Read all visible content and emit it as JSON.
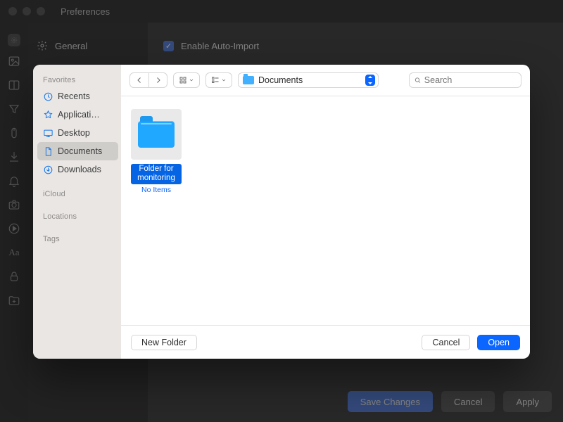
{
  "window": {
    "title": "Preferences"
  },
  "sidebar_general": "General",
  "pref": {
    "auto_import_label": "Enable Auto-Import",
    "save": "Save Changes",
    "cancel": "Cancel",
    "apply": "Apply"
  },
  "chooser": {
    "sidebar": {
      "favorites_heading": "Favorites",
      "icloud_heading": "iCloud",
      "locations_heading": "Locations",
      "tags_heading": "Tags",
      "items": {
        "recents": "Recents",
        "applications": "Applicati…",
        "desktop": "Desktop",
        "documents": "Documents",
        "downloads": "Downloads"
      },
      "selected": "documents"
    },
    "path": {
      "label": "Documents"
    },
    "search": {
      "placeholder": "Search",
      "value": ""
    },
    "items": [
      {
        "name": "Folder for monitoring",
        "subtitle": "No Items",
        "kind": "folder",
        "selected": true
      }
    ],
    "footer": {
      "new_folder": "New Folder",
      "cancel": "Cancel",
      "open": "Open"
    }
  }
}
